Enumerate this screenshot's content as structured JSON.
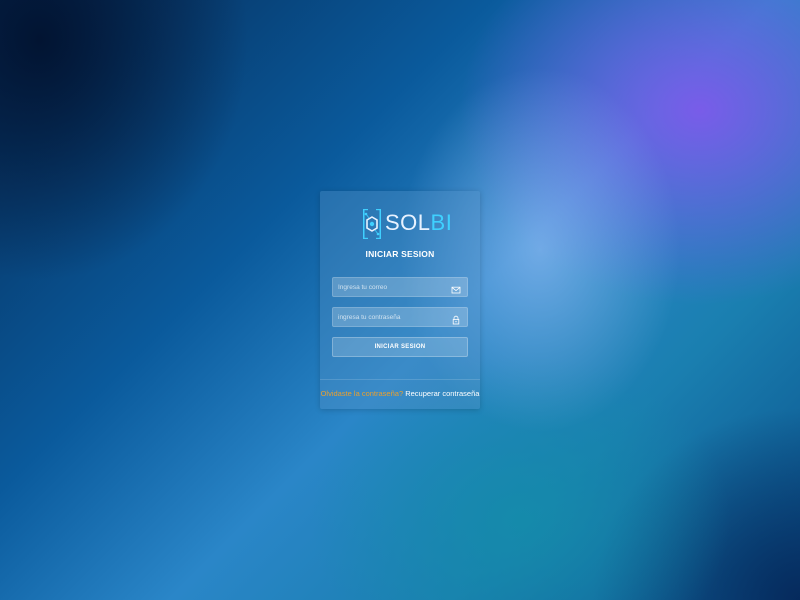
{
  "colors": {
    "accent": "#3fd0ff",
    "warning_link": "#e8a030",
    "card_bg": "rgba(90,150,200,0.35)"
  },
  "brand": {
    "logo_icon": "hexagon-circuit-icon",
    "name_part1": "SOL",
    "name_part2": "BI"
  },
  "login": {
    "title": "INICIAR SESION",
    "email": {
      "placeholder": "Ingresa tu correo",
      "value": "",
      "icon": "mail-icon"
    },
    "password": {
      "placeholder": "ingresa tu contraseña",
      "value": "",
      "icon": "lock-icon"
    },
    "submit_label": "INICIAR SESION"
  },
  "footer": {
    "forgot_text": "Olvidaste la contraseña?",
    "recover_link": "Recuperar contraseña"
  }
}
